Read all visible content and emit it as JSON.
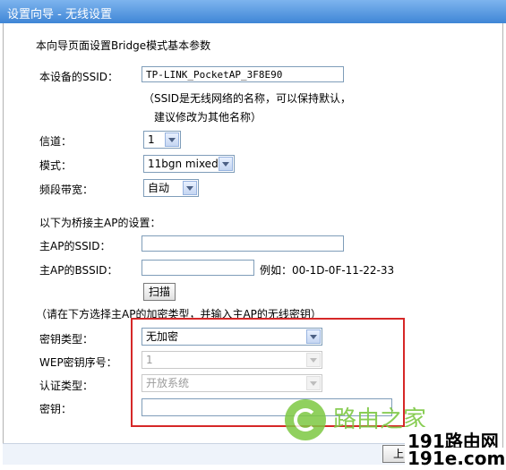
{
  "title": "设置向导 - 无线设置",
  "intro": "本向导页面设置Bridge模式基本参数",
  "ssid": {
    "label": "本设备的SSID：",
    "value": "TP-LINK_PocketAP_3F8E90"
  },
  "hint": {
    "line1": "（SSID是无线网络的名称，可以保持默认，",
    "line2": "建议修改为其他名称）"
  },
  "channel": {
    "label": "信道：",
    "value": "1"
  },
  "mode": {
    "label": "模式：",
    "value": "11bgn mixed"
  },
  "bandwidth": {
    "label": "频段带宽：",
    "value": "自动"
  },
  "bridge_heading": "以下为桥接主AP的设置：",
  "root_ssid": {
    "label": "主AP的SSID：",
    "value": ""
  },
  "root_bssid": {
    "label": "主AP的BSSID：",
    "value": "",
    "example": "例如：00-1D-0F-11-22-33"
  },
  "scan_button": "扫描",
  "encryption_note": "（请在下方选择主AP的加密类型，并输入主AP的无线密钥）",
  "key_type": {
    "label": "密钥类型：",
    "value": "无加密"
  },
  "wep_index": {
    "label": "WEP密钥序号：",
    "value": "1"
  },
  "auth_type": {
    "label": "认证类型：",
    "value": "开放系统"
  },
  "key": {
    "label": "密钥：",
    "value": ""
  },
  "next_button_partial": "上",
  "watermark": {
    "text": "路由之家",
    "site_line1": "191路由网",
    "site_line2": "191e.com"
  },
  "colors": {
    "title_bar": "#5b9be3",
    "highlight_box": "#d62828",
    "watermark_green": "#7dc843"
  }
}
